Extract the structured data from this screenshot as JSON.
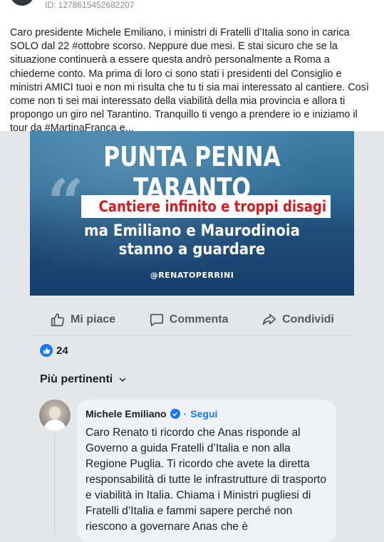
{
  "post": {
    "id_label": "ID: 1278615452682207",
    "text": "Caro presidente Michele Emiliano, i ministri di Fratelli d’Italia sono in carica SOLO dal 22 #ottobre scorso. Neppure due mesi. E stai sicuro che se la situazione continuerà a essere questa andrò personalmente a Roma a chiederne conto. Ma prima di loro ci sono stati i presidenti del Consiglio e ministri AMICI tuoi e non mi risulta che tu ti sia mai interessato al cantiere. Così come non ti sei mai interessato della viabilità della mia provincia e allora ti propongo un giro nel Tarantino. Tranquillo ti vengo a prendere io e iniziamo il tour da #MartinaFranca e..."
  },
  "banner": {
    "title": "PUNTA PENNA TARANTO",
    "highlight": "Cantiere infinito e troppi disagi",
    "subtitle_line1": "ma Emiliano e Maurodinoia",
    "subtitle_line2": "stanno a guardare",
    "handle": "@RENATOPERRINI",
    "colors": {
      "highlight_text": "#d71920",
      "background": "#1f4e79"
    }
  },
  "actions": {
    "like": {
      "label": "Mi piace",
      "icon": "thumbs-up-icon"
    },
    "comment": {
      "label": "Commenta",
      "icon": "comment-icon"
    },
    "share": {
      "label": "Condividi",
      "icon": "share-icon"
    }
  },
  "reactions": {
    "count": "24",
    "icon": "like-badge-icon"
  },
  "comments_filter": {
    "label": "Più pertinenti",
    "icon": "chevron-down-icon"
  },
  "comment": {
    "author": "Michele Emiliano",
    "separator": "·",
    "follow_label": "Segui",
    "text": "Caro Renato ti ricordo che Anas risponde al Governo a guida Fratelli d’Italia e non alla Regione Puglia. Ti ricordo che avete la diretta responsabilità di tutte le infrastrutture di trasporto e viabilità in Italia. Chiama i Ministri pugliesi di Fratelli d’Italia e fammi sapere perché non riescono a governare Anas che è"
  },
  "colors": {
    "accent": "#1877f2",
    "page_bg": "#e4e6e9"
  }
}
